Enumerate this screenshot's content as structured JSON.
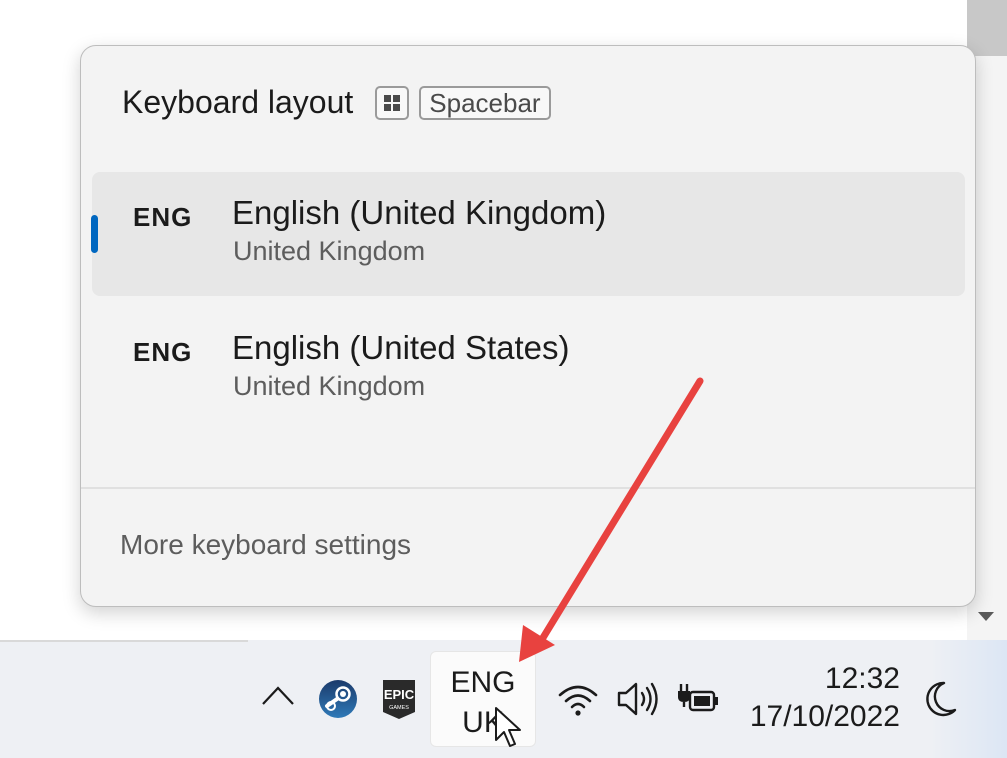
{
  "flyout": {
    "title": "Keyboard layout",
    "shortcut_key_icon": "windows-key-icon",
    "shortcut_key_label": "Spacebar",
    "items": [
      {
        "code": "ENG",
        "name": "English (United Kingdom)",
        "region": "United Kingdom",
        "selected": true
      },
      {
        "code": "ENG",
        "name": "English (United States)",
        "region": "United Kingdom",
        "selected": false
      }
    ],
    "more_settings": "More keyboard settings"
  },
  "taskbar": {
    "icons": [
      "chevron-up-icon",
      "steam-icon",
      "epic-games-icon",
      "wifi-icon",
      "volume-icon",
      "battery-charging-icon",
      "moon-icon"
    ],
    "epic_logo_text": "EPIC GAMES",
    "language_button": {
      "line1": "ENG",
      "line2": "UK"
    },
    "clock": {
      "time": "12:32",
      "date": "17/10/2022"
    }
  },
  "colors": {
    "accent": "#0067c0",
    "annotation_arrow": "#e8423f",
    "flyout_bg": "#f3f3f3",
    "selected_bg": "#e7e7e7"
  }
}
